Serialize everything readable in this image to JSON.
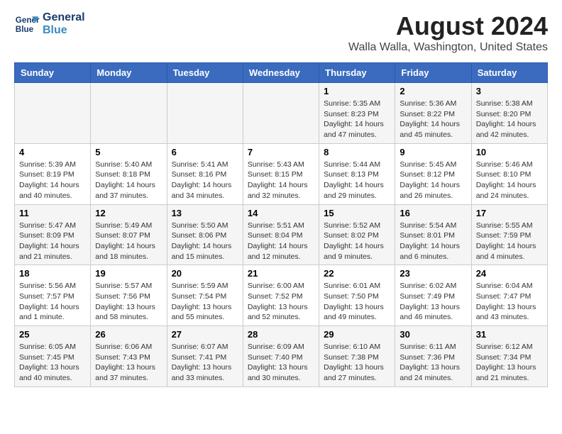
{
  "logo": {
    "line1": "General",
    "line2": "Blue"
  },
  "title": "August 2024",
  "subtitle": "Walla Walla, Washington, United States",
  "days_of_week": [
    "Sunday",
    "Monday",
    "Tuesday",
    "Wednesday",
    "Thursday",
    "Friday",
    "Saturday"
  ],
  "weeks": [
    [
      {
        "day": "",
        "info": ""
      },
      {
        "day": "",
        "info": ""
      },
      {
        "day": "",
        "info": ""
      },
      {
        "day": "",
        "info": ""
      },
      {
        "day": "1",
        "info": "Sunrise: 5:35 AM\nSunset: 8:23 PM\nDaylight: 14 hours and 47 minutes."
      },
      {
        "day": "2",
        "info": "Sunrise: 5:36 AM\nSunset: 8:22 PM\nDaylight: 14 hours and 45 minutes."
      },
      {
        "day": "3",
        "info": "Sunrise: 5:38 AM\nSunset: 8:20 PM\nDaylight: 14 hours and 42 minutes."
      }
    ],
    [
      {
        "day": "4",
        "info": "Sunrise: 5:39 AM\nSunset: 8:19 PM\nDaylight: 14 hours and 40 minutes."
      },
      {
        "day": "5",
        "info": "Sunrise: 5:40 AM\nSunset: 8:18 PM\nDaylight: 14 hours and 37 minutes."
      },
      {
        "day": "6",
        "info": "Sunrise: 5:41 AM\nSunset: 8:16 PM\nDaylight: 14 hours and 34 minutes."
      },
      {
        "day": "7",
        "info": "Sunrise: 5:43 AM\nSunset: 8:15 PM\nDaylight: 14 hours and 32 minutes."
      },
      {
        "day": "8",
        "info": "Sunrise: 5:44 AM\nSunset: 8:13 PM\nDaylight: 14 hours and 29 minutes."
      },
      {
        "day": "9",
        "info": "Sunrise: 5:45 AM\nSunset: 8:12 PM\nDaylight: 14 hours and 26 minutes."
      },
      {
        "day": "10",
        "info": "Sunrise: 5:46 AM\nSunset: 8:10 PM\nDaylight: 14 hours and 24 minutes."
      }
    ],
    [
      {
        "day": "11",
        "info": "Sunrise: 5:47 AM\nSunset: 8:09 PM\nDaylight: 14 hours and 21 minutes."
      },
      {
        "day": "12",
        "info": "Sunrise: 5:49 AM\nSunset: 8:07 PM\nDaylight: 14 hours and 18 minutes."
      },
      {
        "day": "13",
        "info": "Sunrise: 5:50 AM\nSunset: 8:06 PM\nDaylight: 14 hours and 15 minutes."
      },
      {
        "day": "14",
        "info": "Sunrise: 5:51 AM\nSunset: 8:04 PM\nDaylight: 14 hours and 12 minutes."
      },
      {
        "day": "15",
        "info": "Sunrise: 5:52 AM\nSunset: 8:02 PM\nDaylight: 14 hours and 9 minutes."
      },
      {
        "day": "16",
        "info": "Sunrise: 5:54 AM\nSunset: 8:01 PM\nDaylight: 14 hours and 6 minutes."
      },
      {
        "day": "17",
        "info": "Sunrise: 5:55 AM\nSunset: 7:59 PM\nDaylight: 14 hours and 4 minutes."
      }
    ],
    [
      {
        "day": "18",
        "info": "Sunrise: 5:56 AM\nSunset: 7:57 PM\nDaylight: 14 hours and 1 minute."
      },
      {
        "day": "19",
        "info": "Sunrise: 5:57 AM\nSunset: 7:56 PM\nDaylight: 13 hours and 58 minutes."
      },
      {
        "day": "20",
        "info": "Sunrise: 5:59 AM\nSunset: 7:54 PM\nDaylight: 13 hours and 55 minutes."
      },
      {
        "day": "21",
        "info": "Sunrise: 6:00 AM\nSunset: 7:52 PM\nDaylight: 13 hours and 52 minutes."
      },
      {
        "day": "22",
        "info": "Sunrise: 6:01 AM\nSunset: 7:50 PM\nDaylight: 13 hours and 49 minutes."
      },
      {
        "day": "23",
        "info": "Sunrise: 6:02 AM\nSunset: 7:49 PM\nDaylight: 13 hours and 46 minutes."
      },
      {
        "day": "24",
        "info": "Sunrise: 6:04 AM\nSunset: 7:47 PM\nDaylight: 13 hours and 43 minutes."
      }
    ],
    [
      {
        "day": "25",
        "info": "Sunrise: 6:05 AM\nSunset: 7:45 PM\nDaylight: 13 hours and 40 minutes."
      },
      {
        "day": "26",
        "info": "Sunrise: 6:06 AM\nSunset: 7:43 PM\nDaylight: 13 hours and 37 minutes."
      },
      {
        "day": "27",
        "info": "Sunrise: 6:07 AM\nSunset: 7:41 PM\nDaylight: 13 hours and 33 minutes."
      },
      {
        "day": "28",
        "info": "Sunrise: 6:09 AM\nSunset: 7:40 PM\nDaylight: 13 hours and 30 minutes."
      },
      {
        "day": "29",
        "info": "Sunrise: 6:10 AM\nSunset: 7:38 PM\nDaylight: 13 hours and 27 minutes."
      },
      {
        "day": "30",
        "info": "Sunrise: 6:11 AM\nSunset: 7:36 PM\nDaylight: 13 hours and 24 minutes."
      },
      {
        "day": "31",
        "info": "Sunrise: 6:12 AM\nSunset: 7:34 PM\nDaylight: 13 hours and 21 minutes."
      }
    ]
  ]
}
